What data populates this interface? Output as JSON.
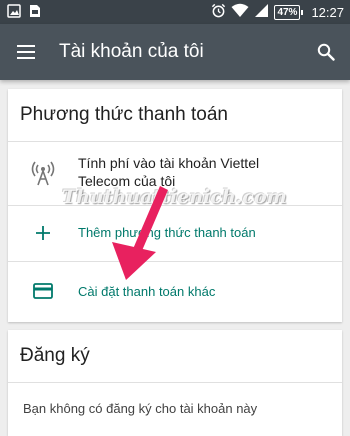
{
  "status_bar": {
    "battery": "47%",
    "time": "12:27"
  },
  "app_bar": {
    "title": "Tài khoản của tôi",
    "menu_icon": "hamburger-icon",
    "search_icon": "search-icon"
  },
  "payment_card": {
    "title": "Phương thức thanh toán",
    "carrier_line1": "Tính phí vào tài khoản Viettel",
    "carrier_line2": "Telecom của tôi",
    "add_method": "Thêm phương thức thanh toán",
    "other_settings": "Cài đặt thanh toán khác"
  },
  "subscriptions_card": {
    "title": "Đăng ký",
    "empty_text": "Bạn không có đăng ký cho tài khoản này"
  },
  "watermark": "Thuthuattienich.com",
  "colors": {
    "status_bar": "#3a4249",
    "app_bar": "#4a535b",
    "link": "#00796b",
    "arrow": "#e8215f"
  }
}
